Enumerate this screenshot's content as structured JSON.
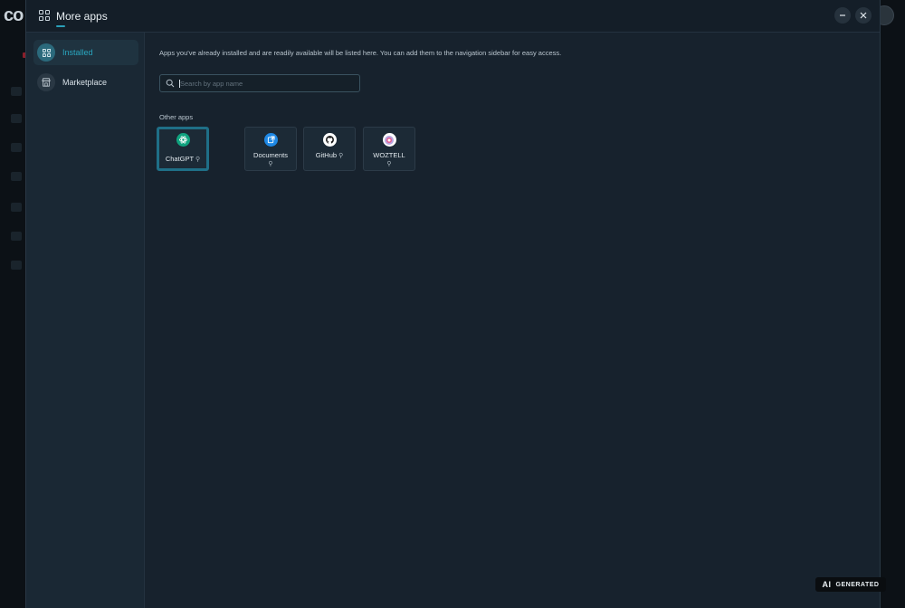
{
  "modal": {
    "title": "More apps",
    "icon": "grid-icon"
  },
  "sidebar": {
    "items": [
      {
        "label": "Installed",
        "icon": "grid-icon",
        "active": true
      },
      {
        "label": "Marketplace",
        "icon": "store-icon",
        "active": false
      }
    ]
  },
  "main": {
    "description": "Apps you've already installed and are readily available will be listed here. You can add them to the navigation sidebar for easy access.",
    "search_placeholder": "Search by app name",
    "section_label": "Other apps",
    "apps": [
      {
        "name": "ChatGPT",
        "icon": "chatgpt-logo-icon",
        "color": "#10a37f",
        "selected": true
      },
      {
        "name": "Documents",
        "icon": "documents-icon",
        "color": "#1e88e5",
        "selected": false
      },
      {
        "name": "GitHub",
        "icon": "github-icon",
        "color": "#ffffff",
        "selected": false
      },
      {
        "name": "WOZTELL",
        "icon": "woztell-icon",
        "color": "#8e7cc3",
        "selected": false
      }
    ]
  },
  "badge": {
    "ai": "AI",
    "text": "GENERATED"
  },
  "colors": {
    "accent": "#2aa7c0",
    "modal_bg": "#17222d",
    "sidebar_bg": "#1a2834"
  }
}
